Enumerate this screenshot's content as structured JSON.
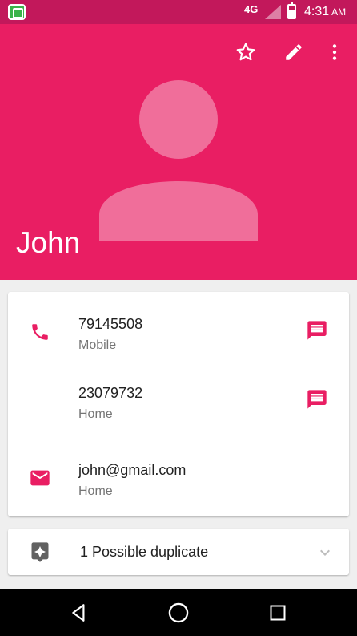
{
  "status_bar": {
    "network": "4G",
    "time": "4:31",
    "ampm": "AM"
  },
  "header": {
    "name": "John",
    "actions": [
      "star-icon",
      "edit-icon",
      "more-vert-icon"
    ]
  },
  "contact": {
    "phones": [
      {
        "number": "79145508",
        "type": "Mobile"
      },
      {
        "number": "23079732",
        "type": "Home"
      }
    ],
    "email": {
      "address": "john@gmail.com",
      "type": "Home"
    }
  },
  "duplicates": {
    "label": "1 Possible duplicate"
  },
  "colors": {
    "accent": "#e91e63",
    "status_bar": "#c2185b",
    "avatar_fill": "#f06e9a"
  },
  "nav": [
    "back-icon",
    "home-icon",
    "recents-icon"
  ]
}
